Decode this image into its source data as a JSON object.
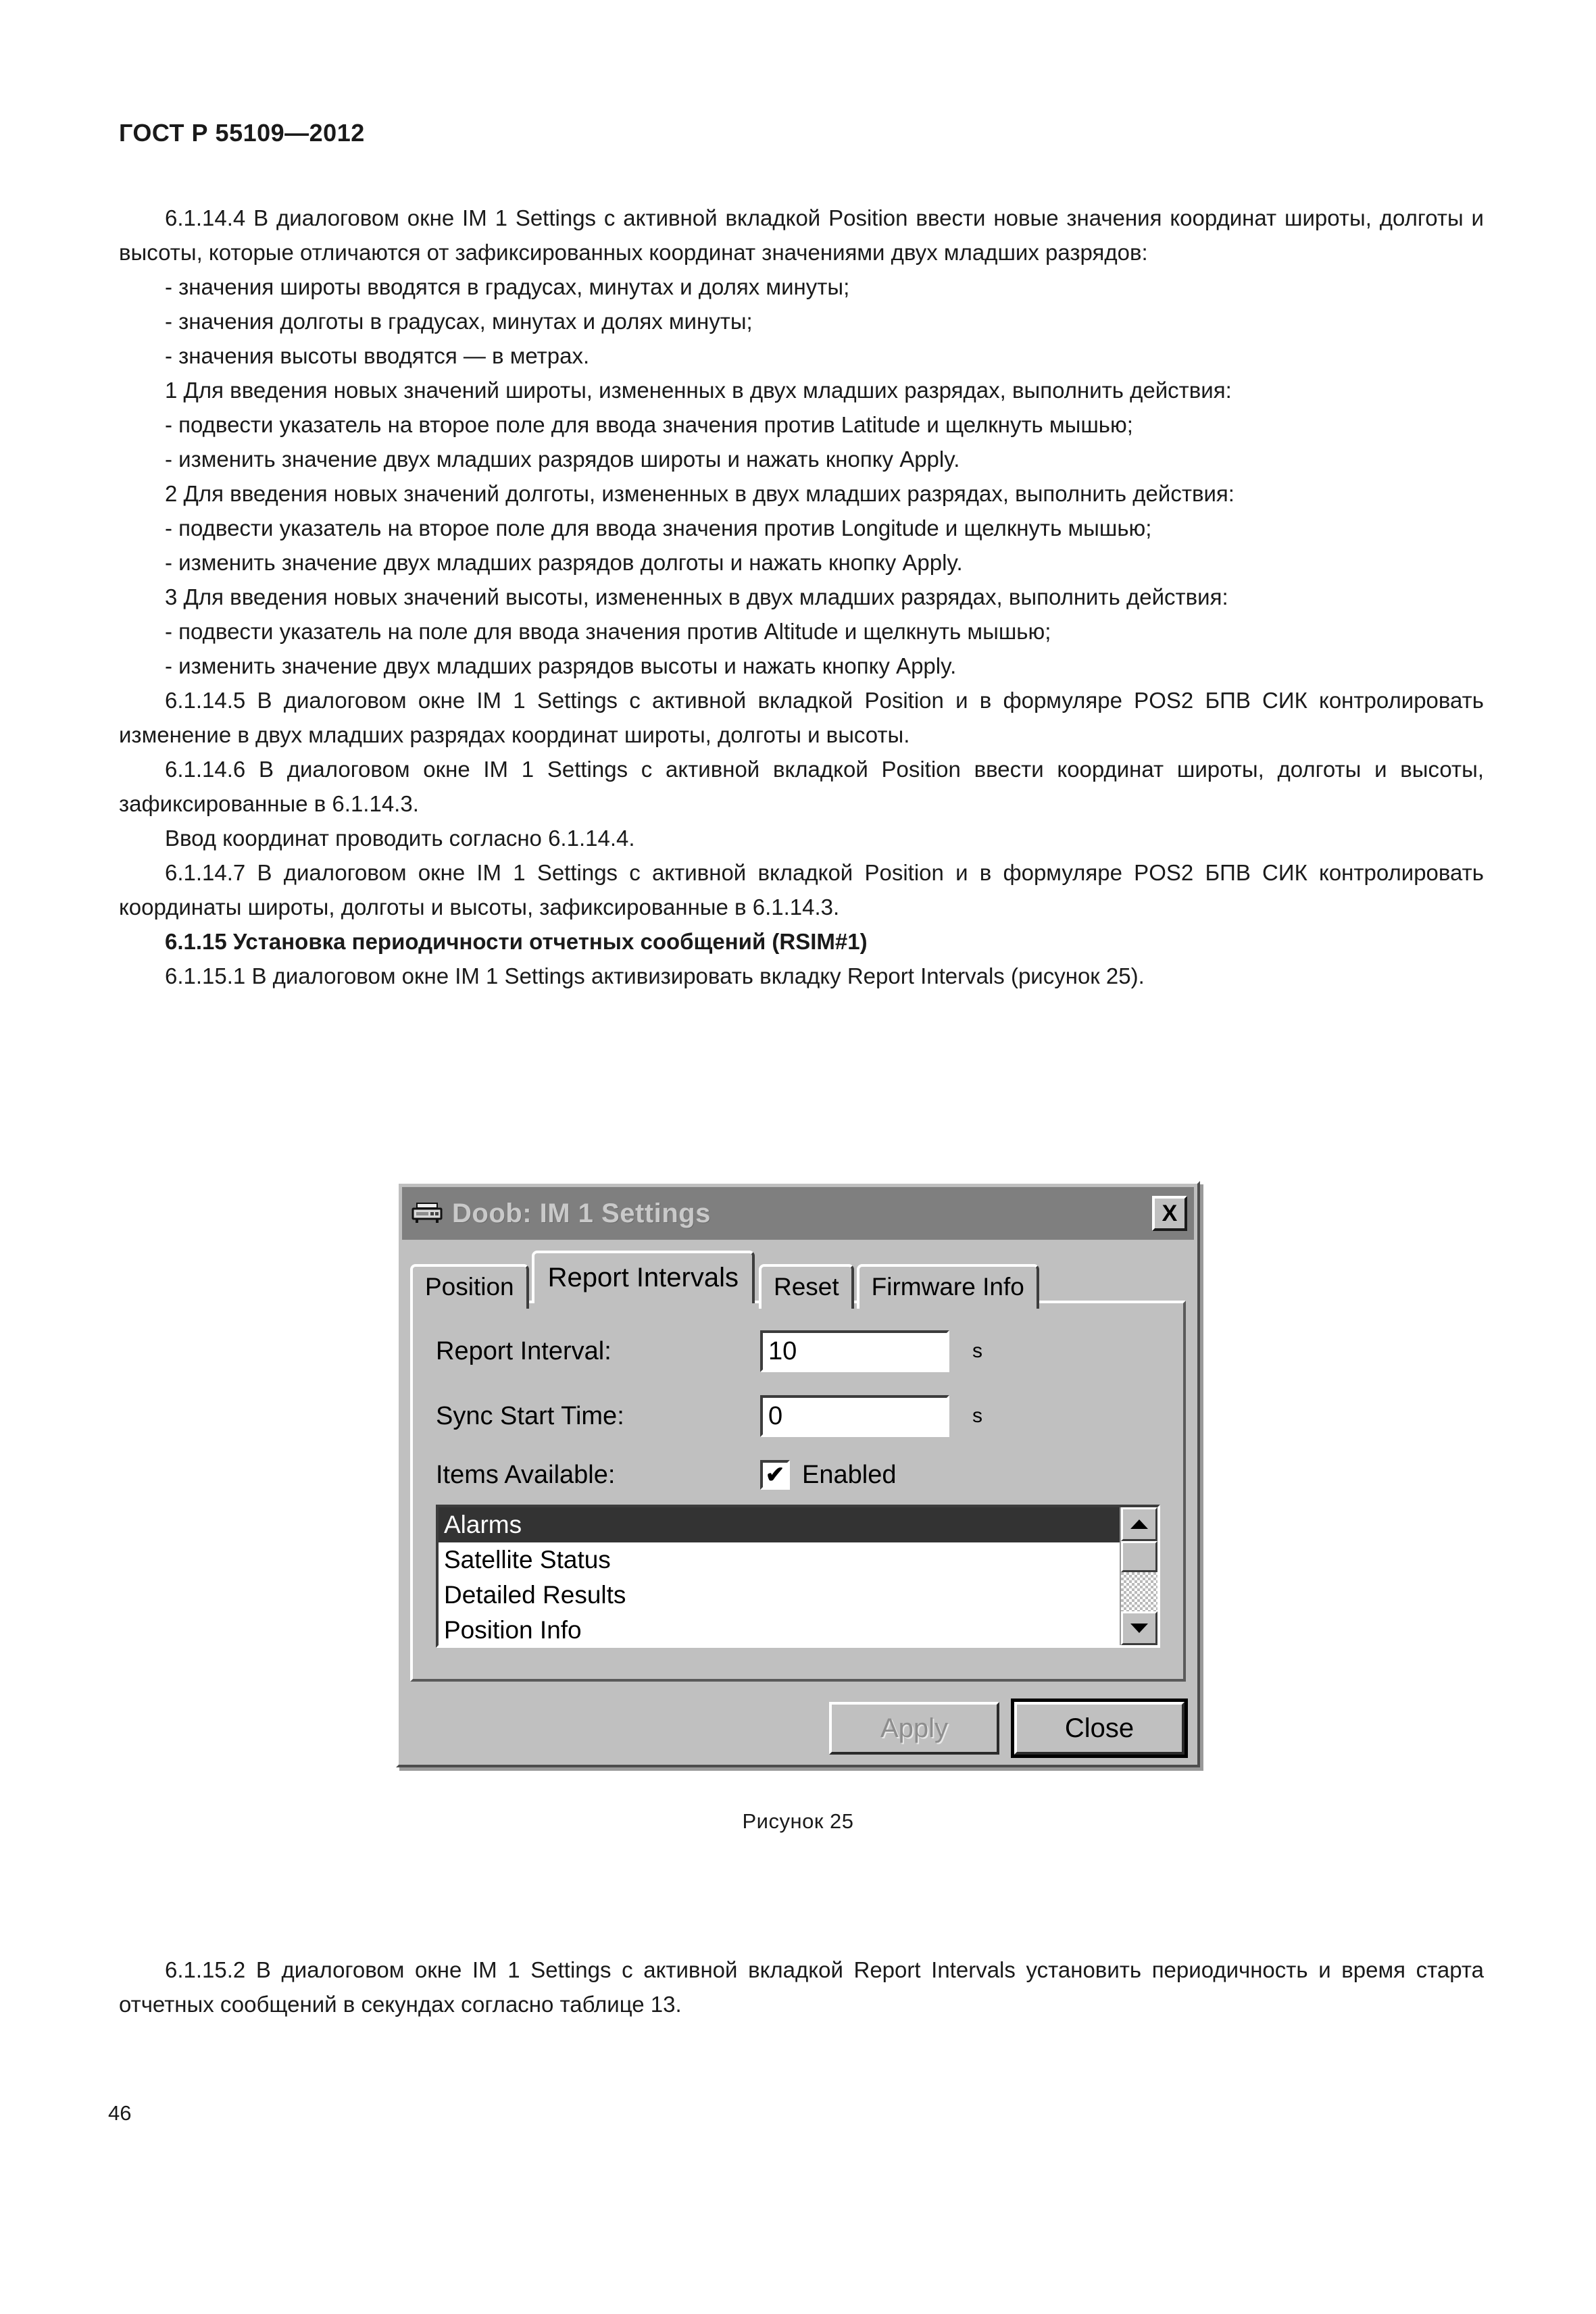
{
  "document": {
    "header": "ГОСТ Р 55109—2012",
    "page_number": "46"
  },
  "body": {
    "p_6_1_14_4": "6.1.14.4 В диалоговом окне IM 1 Settings с активной вкладкой Position ввести новые значения коорди­нат широты, долготы и высоты, которые отличаются от зафиксированных координат значениями двух млад­ших разрядов:",
    "bullet_lat_units": "- значения широты вводятся в градусах, минутах и долях минуты;",
    "bullet_lon_units": "- значения долготы в градусах, минутах и долях минуты;",
    "bullet_alt_units": "- значения высоты вводятся — в метрах.",
    "step1_title": "1 Для введения новых значений широты,  измененных в двух младших разрядах, выполнить действия:",
    "step1_a": "- подвести указатель на второе поле для ввода значения против Latitude и щелкнуть мышью;",
    "step1_b": "- изменить значение двух младших разрядов широты и нажать кнопку Apply.",
    "step2_title": "2 Для введения новых значений долготы, измененных в двух младших разрядах, выполнить действия:",
    "step2_a": "- подвести указатель на второе поле для ввода значения против Longitude и щелкнуть мышью;",
    "step2_b": "- изменить значение двух младших разрядов долготы и нажать кнопку Apply.",
    "step3_title": "3 Для введения новых значений высоты, измененных в двух младших разрядах, выполнить действия:",
    "step3_a": "- подвести указатель на поле для ввода значения против Altitude и щелкнуть мышью;",
    "step3_b": "- изменить значение двух младших разрядов высоты и нажать кнопку Apply.",
    "p_6_1_14_5": "6.1.14.5 В диалоговом окне IM 1 Settings с активной вкладкой Position и в формуляре POS2 БПВ СИК контролировать изменение в двух младших разрядах координат широты, долготы и  высоты.",
    "p_6_1_14_6": "6.1.14.6 В диалоговом окне IM 1 Settings с активной вкладкой Position ввести координат широты, долготы и высоты, зафиксированные в 6.1.14.3.",
    "p_input_note": "Ввод координат проводить согласно  6.1.14.4.",
    "p_6_1_14_7": "6.1.14.7 В диалоговом окне IM 1 Settings с активной вкладкой Position и в формуляре POS2 БПВ СИК контролировать координаты широты, долготы и высоты, зафиксированные в 6.1.14.3.",
    "h_6_1_15": "6.1.15 Установка периодичности отчетных сообщений (RSIM#1)",
    "p_6_1_15_1": "6.1.15.1 В диалоговом окне IM 1 Settings активизировать вкладку Report Intervals (рисунок 25).",
    "p_6_1_15_2": "6.1.15.2 В диалоговом окне IM 1 Settings с активной вкладкой Report Intervals установить периодич­ность и время старта отчетных сообщений в секундах согласно таблице 13."
  },
  "figure": {
    "caption": "Рисунок 25",
    "dialog": {
      "title": "Doob: IM 1 Settings",
      "title_icon": "device-icon",
      "close_label": "X",
      "tabs": [
        {
          "label": "Position",
          "active": false
        },
        {
          "label": "Report Intervals",
          "active": true
        },
        {
          "label": "Reset",
          "active": false
        },
        {
          "label": "Firmware Info",
          "active": false
        }
      ],
      "fields": [
        {
          "label": "Report Interval:",
          "value": "10",
          "unit": "s"
        },
        {
          "label": "Sync Start Time:",
          "value": "0",
          "unit": "s"
        }
      ],
      "items_available_label": "Items Available:",
      "enabled_checkbox": {
        "label": "Enabled",
        "checked": true,
        "glyph": "✔"
      },
      "list_items": [
        {
          "label": "Alarms",
          "selected": true
        },
        {
          "label": "Satellite Status",
          "selected": false
        },
        {
          "label": "Detailed Results",
          "selected": false
        },
        {
          "label": "Position Info",
          "selected": false
        }
      ],
      "buttons": [
        {
          "label": "Apply",
          "enabled": false,
          "default": false
        },
        {
          "label": "Close",
          "enabled": true,
          "default": true
        }
      ],
      "colors": {
        "face": "#c0c0c0",
        "titlebar": "#7f7f7f",
        "title_text": "#c9c9c9",
        "selection": "#333333",
        "field_bg": "#ffffff"
      }
    }
  }
}
